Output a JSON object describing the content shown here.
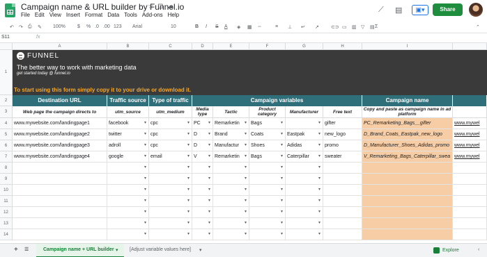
{
  "doc": {
    "title": "Campaign name & URL builder by Funnel.io"
  },
  "menu": [
    "File",
    "Edit",
    "View",
    "Insert",
    "Format",
    "Data",
    "Tools",
    "Add-ons",
    "Help"
  ],
  "header_actions": {
    "share": "Share"
  },
  "toolbar": {
    "zoom": "100%",
    "currency": "$",
    "percent": "%",
    "dec_less": ".0",
    "dec_more": ".00",
    "more_formats": "123",
    "font": "Arial",
    "size": "10",
    "bold": "B",
    "italic": "I",
    "strike": "S",
    "text_color": "A",
    "sum": "Σ"
  },
  "formula_bar": {
    "cell_ref": "S11",
    "fx": "fx"
  },
  "columns": [
    "A",
    "B",
    "C",
    "D",
    "E",
    "F",
    "G",
    "H",
    "I"
  ],
  "rows": [
    "1",
    "2",
    "3",
    "4",
    "5",
    "6",
    "7",
    "8",
    "9",
    "10",
    "11",
    "12",
    "13",
    "14"
  ],
  "banner": {
    "brand": "FUNNEL",
    "tagline": "The better way to work with marketing data",
    "subline": "get started today @ funnel.io",
    "cta": "To start using this form simply copy it to your drive or download it."
  },
  "sections": {
    "destination": "Destination URL",
    "traffic_source": "Traffic source",
    "traffic_type": "Type of traffic",
    "campaign_vars": "Campaign variables",
    "campaign_name": "Campaign name"
  },
  "subheaders": [
    "Web page the campaign directs to",
    "utm_source",
    "utm_medium",
    "Media type",
    "Tactic",
    "Product category",
    "Manufacturer",
    "Free text",
    "Copy and paste as campaign name in ad platform"
  ],
  "data_rows": [
    {
      "url": "www.mywebsite.com/landingpage1",
      "source": "facebook",
      "medium": "cpc",
      "media": "PC",
      "tactic": "Remarketin",
      "category": "Bags",
      "manufacturer": "",
      "free": "gifter",
      "name": "PC_Remarketing_Bags__gifter",
      "link": "www.mywel"
    },
    {
      "url": "www.mywebsite.com/landingpage2",
      "source": "twitter",
      "medium": "cpc",
      "media": "D",
      "tactic": "Brand",
      "category": "Coats",
      "manufacturer": "Eastpak",
      "free": "new_logo",
      "name": "D_Brand_Coats_Eastpak_new_logo",
      "link": "www.mywel"
    },
    {
      "url": "www.mywebsite.com/landingpage3",
      "source": "adroll",
      "medium": "cpc",
      "media": "D",
      "tactic": "Manufactur",
      "category": "Shoes",
      "manufacturer": "Adidas",
      "free": "promo",
      "name": "D_Manufacturer_Shoes_Adidas_promo",
      "link": "www.mywel"
    },
    {
      "url": "www.mywebsite.com/landingpage4",
      "source": "google",
      "medium": "email",
      "media": "V",
      "tactic": "Remarketin",
      "category": "Bags",
      "manufacturer": "Caterpillar",
      "free": "sweater",
      "name": "V_Remarketing_Bags_Caterpillar_swea",
      "link": "www.mywel"
    }
  ],
  "sheet_tabs": {
    "active": "Campaign name + URL builder",
    "other": "[Adjust variable values here]"
  },
  "explore": "Explore"
}
